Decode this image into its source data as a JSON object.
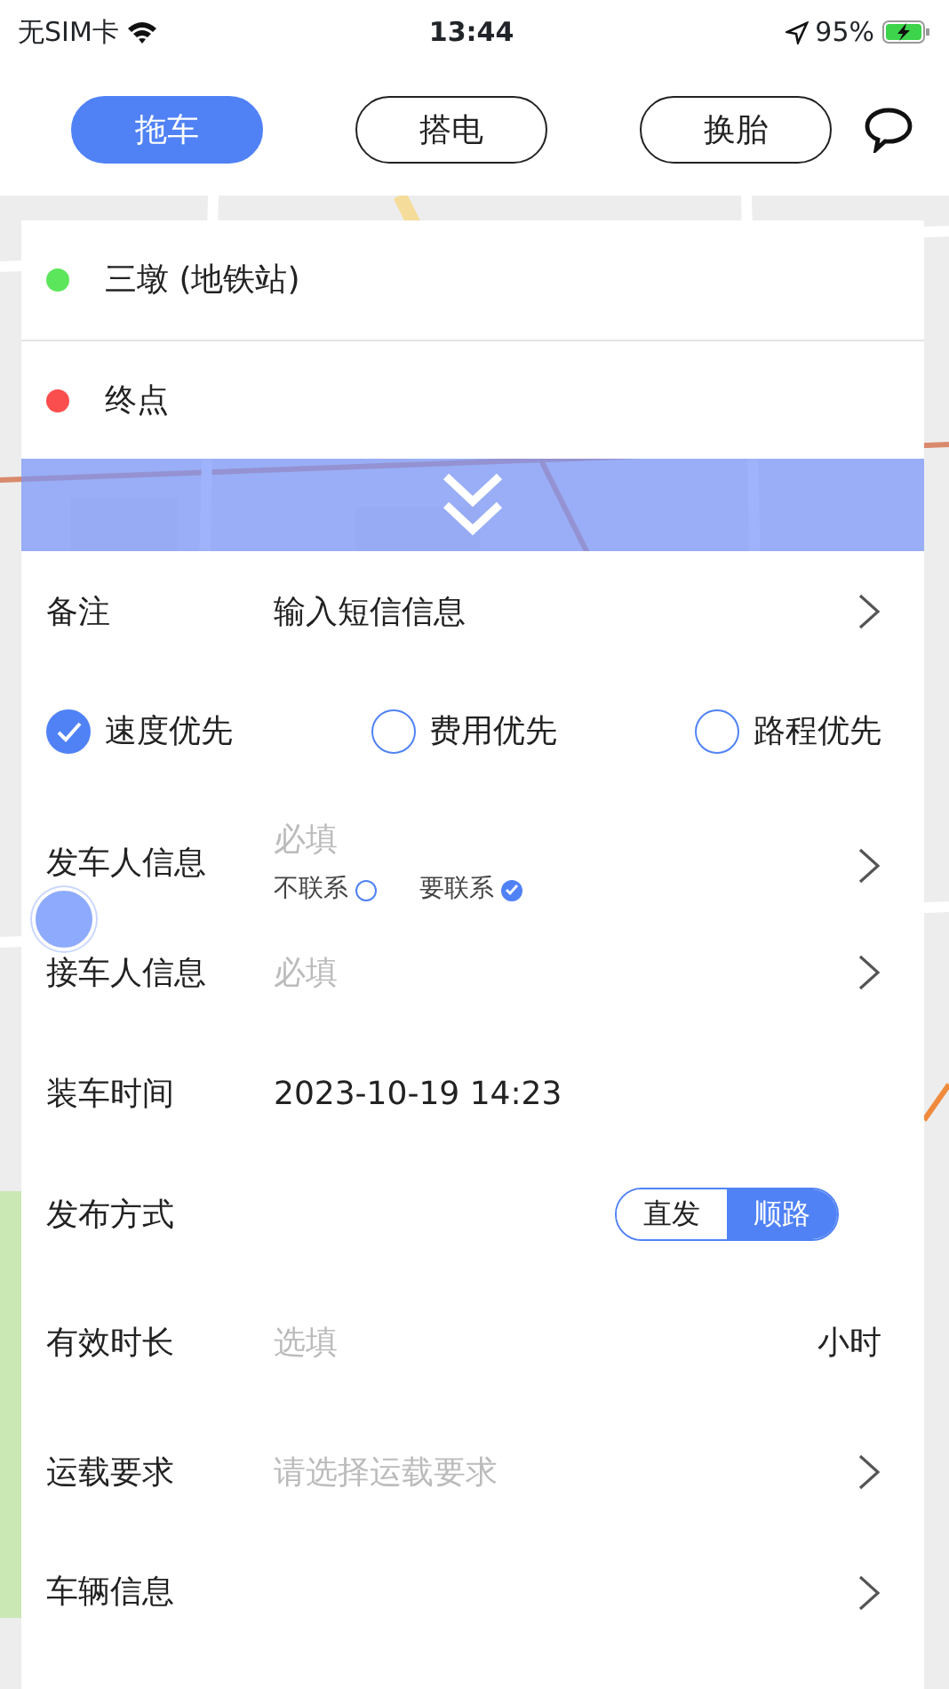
{
  "status_bar": {
    "carrier": "无SIM卡",
    "time": "13:44",
    "battery": "95%"
  },
  "tabs": [
    {
      "label": "拖车",
      "selected": true
    },
    {
      "label": "搭电",
      "selected": false
    },
    {
      "label": "换胎",
      "selected": false
    }
  ],
  "route": [
    {
      "text": "三墩 (地铁站)",
      "color": "#5ce65c"
    },
    {
      "text": "终点",
      "color": "#fa4d4d"
    }
  ],
  "form": [
    {
      "kind": "input",
      "label": "备注",
      "value": "输入短信信息",
      "arrow": true
    },
    {
      "kind": "options",
      "options": [
        {
          "label": "速度优先",
          "selected": true
        },
        {
          "label": "费用优先",
          "selected": false
        },
        {
          "label": "路程优先",
          "selected": false
        }
      ]
    },
    {
      "kind": "input",
      "label": "发车人信息",
      "placeholder": "必填",
      "arrow": true,
      "contact": [
        {
          "label": "不联系",
          "selected": false
        },
        {
          "label": "要联系",
          "selected": true
        }
      ]
    },
    {
      "kind": "input",
      "label": "接车人信息",
      "placeholder": "必填",
      "arrow": true
    },
    {
      "kind": "input",
      "label": "装车时间",
      "value": "2023-10-19 14:23",
      "arrow": false
    },
    {
      "kind": "segmented",
      "label": "发布方式",
      "options": [
        {
          "label": "直发",
          "selected": false
        },
        {
          "label": "顺路",
          "selected": true
        }
      ]
    },
    {
      "kind": "input",
      "label": "有效时长",
      "placeholder": "选填",
      "unit": "小时",
      "arrow": false
    },
    {
      "kind": "input",
      "label": "运载要求",
      "placeholder": "请选择运载要求",
      "arrow": true
    },
    {
      "kind": "input",
      "label": "车辆信息",
      "arrow": true
    }
  ]
}
